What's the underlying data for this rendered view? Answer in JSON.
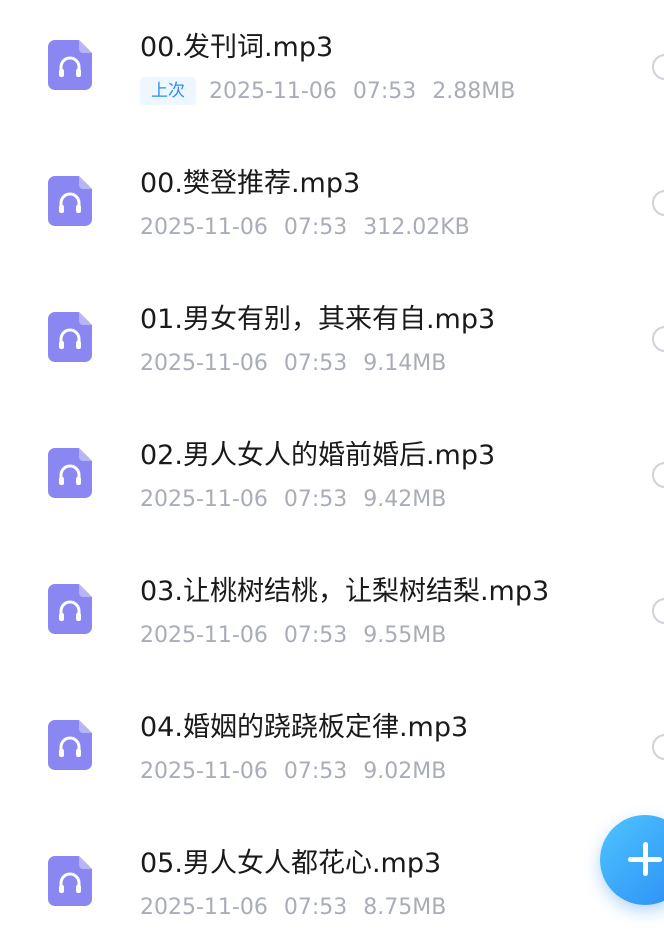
{
  "files": [
    {
      "name": "00.发刊词.mp3",
      "badge": "上次",
      "date": "2025-11-06",
      "time": "07:53",
      "size": "2.88MB",
      "icon": "audio-file-icon"
    },
    {
      "name": "00.樊登推荐.mp3",
      "badge": "",
      "date": "2025-11-06",
      "time": "07:53",
      "size": "312.02KB",
      "icon": "audio-file-icon"
    },
    {
      "name": "01.男女有别，其来有自.mp3",
      "badge": "",
      "date": "2025-11-06",
      "time": "07:53",
      "size": "9.14MB",
      "icon": "audio-file-icon"
    },
    {
      "name": "02.男人女人的婚前婚后.mp3",
      "badge": "",
      "date": "2025-11-06",
      "time": "07:53",
      "size": "9.42MB",
      "icon": "audio-file-icon"
    },
    {
      "name": "03.让桃树结桃，让梨树结梨.mp3",
      "badge": "",
      "date": "2025-11-06",
      "time": "07:53",
      "size": "9.55MB",
      "icon": "audio-file-icon"
    },
    {
      "name": "04.婚姻的跷跷板定律.mp3",
      "badge": "",
      "date": "2025-11-06",
      "time": "07:53",
      "size": "9.02MB",
      "icon": "audio-file-icon"
    },
    {
      "name": "05.男人女人都花心.mp3",
      "badge": "",
      "date": "2025-11-06",
      "time": "07:53",
      "size": "8.75MB",
      "icon": "audio-file-icon"
    }
  ],
  "fab": {
    "icon": "plus-icon"
  },
  "colors": {
    "accent": "#2a8df5",
    "icon_purple": "#8a87f2",
    "meta_gray": "#a9adb8",
    "badge_bg": "#eef6ff"
  }
}
